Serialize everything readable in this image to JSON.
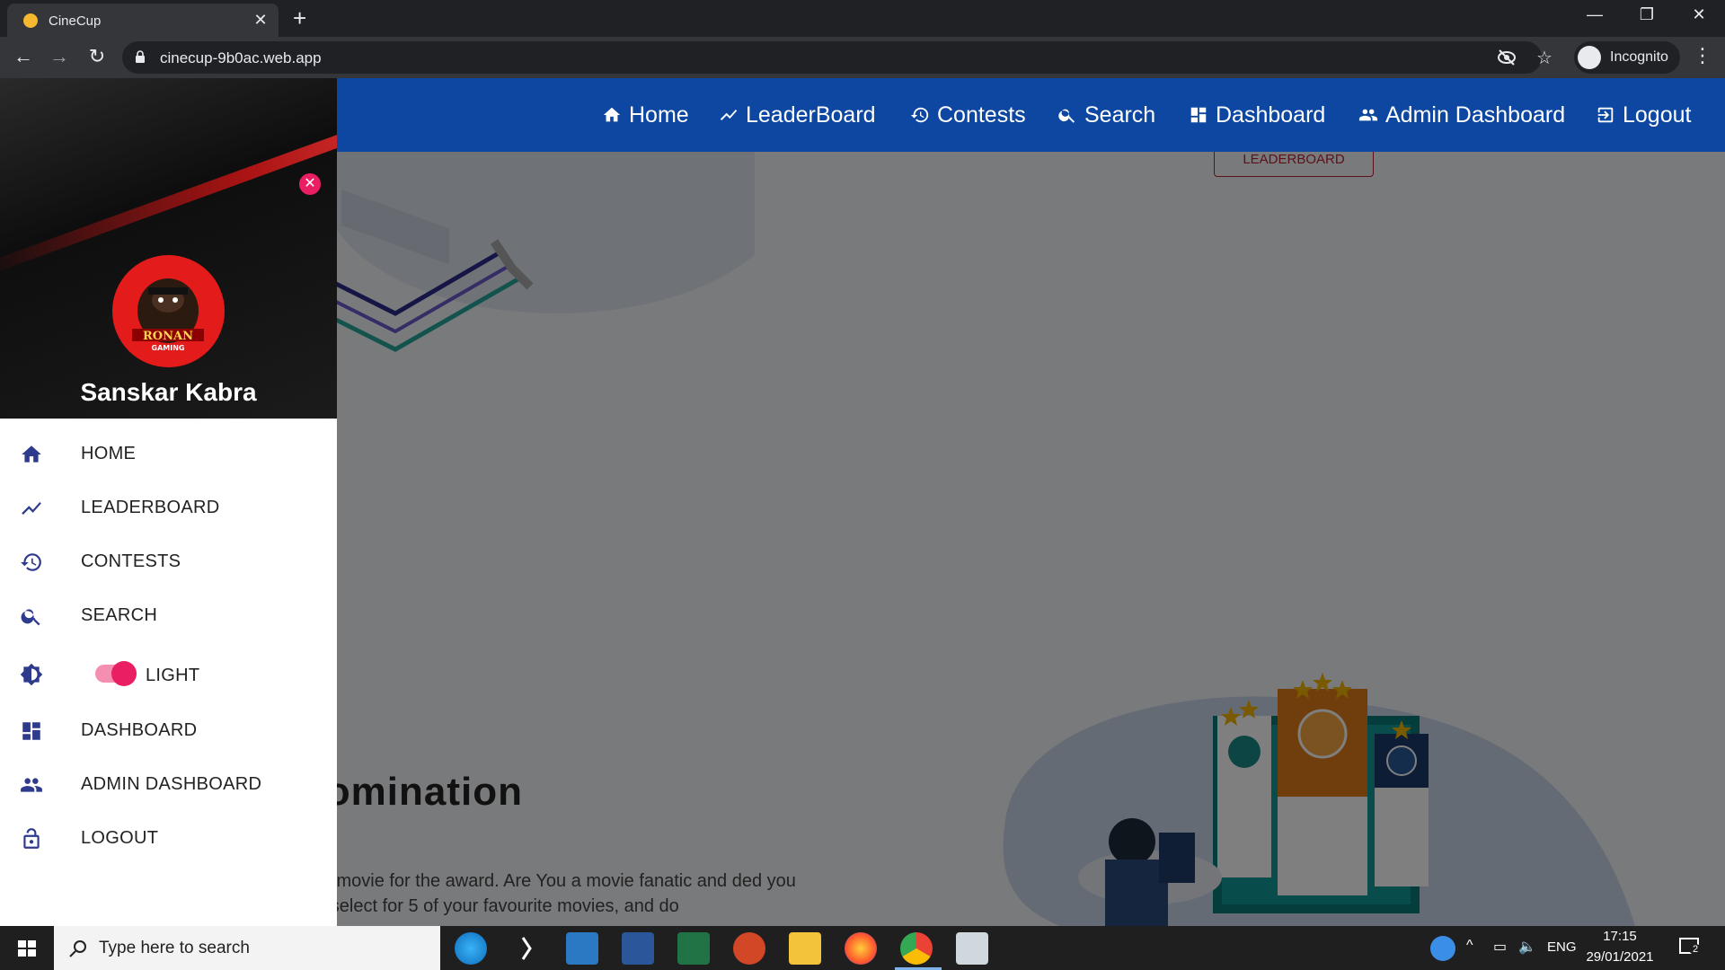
{
  "browser": {
    "tab_title": "CineCup",
    "tab_close": "✕",
    "new_tab": "+",
    "url": "cinecup-9b0ac.web.app",
    "incognito_label": "Incognito",
    "window_controls": [
      "—",
      "❐",
      "✕"
    ]
  },
  "app_nav": {
    "items": [
      {
        "label": "Home",
        "icon": "home-icon"
      },
      {
        "label": "LeaderBoard",
        "icon": "trending-icon"
      },
      {
        "label": "Contests",
        "icon": "history-icon"
      },
      {
        "label": "Search",
        "icon": "search-icon"
      },
      {
        "label": "Dashboard",
        "icon": "dashboard-icon"
      },
      {
        "label": "Admin Dashboard",
        "icon": "people-icon"
      },
      {
        "label": "Logout",
        "icon": "logout-icon"
      }
    ],
    "bar_color": "#0d47a1"
  },
  "page": {
    "leaderboard_button": "LEADERBOARD",
    "nomination_title": "Nomination",
    "nomination_text": "urite movie for the award. Are You a movie fanatic and ded you can select for 5 of your favourite movies, and do"
  },
  "drawer": {
    "close_icon": "✕",
    "avatar_text_top": "RONAN",
    "avatar_text_bottom": "GAMING",
    "user_name": "Sanskar Kabra",
    "items": [
      {
        "label": "HOME",
        "icon": "home-icon"
      },
      {
        "label": "LEADERBOARD",
        "icon": "trending-icon"
      },
      {
        "label": "CONTESTS",
        "icon": "history-icon"
      },
      {
        "label": "SEARCH",
        "icon": "search-icon"
      },
      {
        "label": "LIGHT",
        "icon": "brightness-icon",
        "toggle_on": true
      },
      {
        "label": "DASHBOARD",
        "icon": "dashboard-icon"
      },
      {
        "label": "ADMIN DASHBOARD",
        "icon": "people-icon"
      },
      {
        "label": "LOGOUT",
        "icon": "lock-icon"
      }
    ],
    "accent_color": "#e91e63",
    "icon_color": "#2e3a8c"
  },
  "taskbar": {
    "search_placeholder": "Type here to search",
    "lang": "ENG",
    "time": "17:15",
    "date": "29/01/2021",
    "notification_count": "2",
    "apps": [
      "edge-icon",
      "app-icon",
      "store-icon",
      "word-icon",
      "excel-icon",
      "powerpoint-icon",
      "file-explorer-icon",
      "firefox-icon",
      "chrome-icon",
      "remote-icon"
    ]
  }
}
